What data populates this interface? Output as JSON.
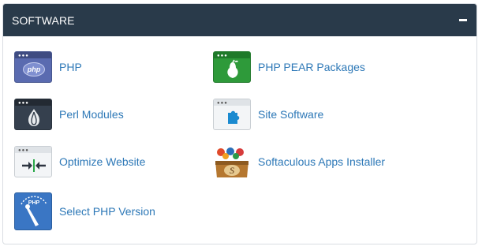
{
  "panel": {
    "title": "SOFTWARE",
    "collapse_icon": "minus-icon"
  },
  "items": [
    {
      "label": "PHP",
      "icon": "php-icon"
    },
    {
      "label": "PHP PEAR Packages",
      "icon": "pear-icon"
    },
    {
      "label": "Perl Modules",
      "icon": "perl-onion-icon"
    },
    {
      "label": "Site Software",
      "icon": "puzzle-piece-icon"
    },
    {
      "label": "Optimize Website",
      "icon": "compress-arrows-icon"
    },
    {
      "label": "Softaculous Apps Installer",
      "icon": "softaculous-box-icon"
    },
    {
      "label": "Select PHP Version",
      "icon": "php-version-gauge-icon"
    }
  ],
  "colors": {
    "header_bg": "#293a4a",
    "link": "#2d78b7",
    "php_icon": "#5a6bb0",
    "pear_icon": "#2e9a3a",
    "perl_icon": "#35404e",
    "version_icon": "#3a76c4"
  },
  "icon_text": {
    "php": "php",
    "php_version": "PHP",
    "soft_letter": "S"
  }
}
